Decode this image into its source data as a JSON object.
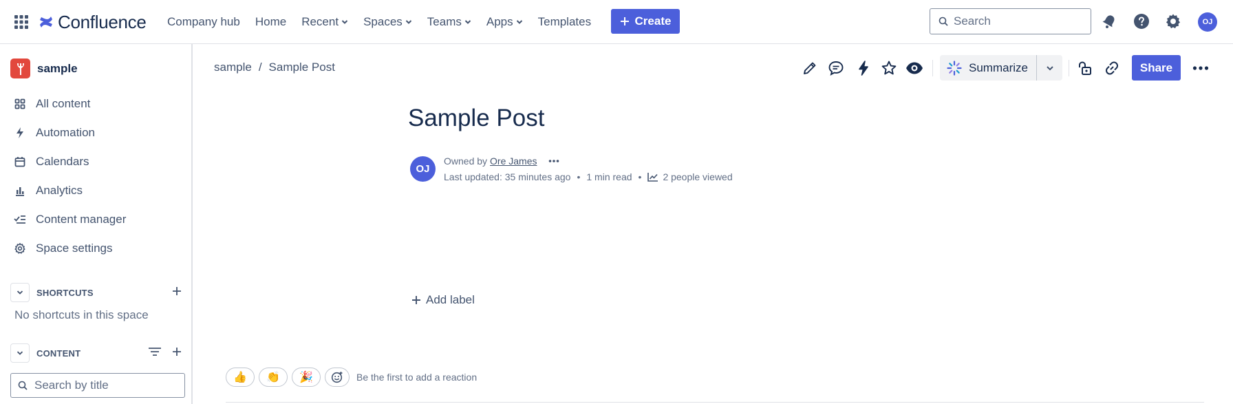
{
  "app": {
    "name": "Confluence"
  },
  "topnav": {
    "links": [
      {
        "label": "Company hub",
        "dropdown": false
      },
      {
        "label": "Home",
        "dropdown": false
      },
      {
        "label": "Recent",
        "dropdown": true
      },
      {
        "label": "Spaces",
        "dropdown": true
      },
      {
        "label": "Teams",
        "dropdown": true
      },
      {
        "label": "Apps",
        "dropdown": true
      },
      {
        "label": "Templates",
        "dropdown": false
      }
    ],
    "create_label": "Create",
    "search_placeholder": "Search",
    "avatar_initials": "OJ"
  },
  "sidebar": {
    "space_name": "sample",
    "items": [
      {
        "label": "All content",
        "icon": "grid-icon"
      },
      {
        "label": "Automation",
        "icon": "lightning-icon"
      },
      {
        "label": "Calendars",
        "icon": "calendar-icon"
      },
      {
        "label": "Analytics",
        "icon": "bar-chart-icon"
      },
      {
        "label": "Content manager",
        "icon": "checklist-icon"
      },
      {
        "label": "Space settings",
        "icon": "gear-icon"
      }
    ],
    "shortcuts_label": "SHORTCUTS",
    "no_shortcuts_text": "No shortcuts in this space",
    "content_label": "CONTENT",
    "title_search_placeholder": "Search by title"
  },
  "breadcrumb": {
    "items": [
      "sample",
      "/",
      "Sample Post"
    ]
  },
  "toolbar": {
    "summarize_label": "Summarize",
    "share_label": "Share"
  },
  "page": {
    "title": "Sample Post",
    "owner_prefix": "Owned by",
    "owner_name": "Ore James",
    "owner_initials": "OJ",
    "last_updated": "Last updated: 35 minutes ago",
    "read_time": "1 min read",
    "views": "2 people viewed",
    "separator": "•",
    "add_label_text": "Add label"
  },
  "reactions": {
    "emojis": [
      "👍",
      "👏",
      "🎉"
    ],
    "prompt_text": "Be the first to add a reaction"
  },
  "colors": {
    "brand": "#4c5fdb",
    "space_logo": "#e2483d",
    "text": "#172b4d",
    "muted": "#44546f"
  }
}
